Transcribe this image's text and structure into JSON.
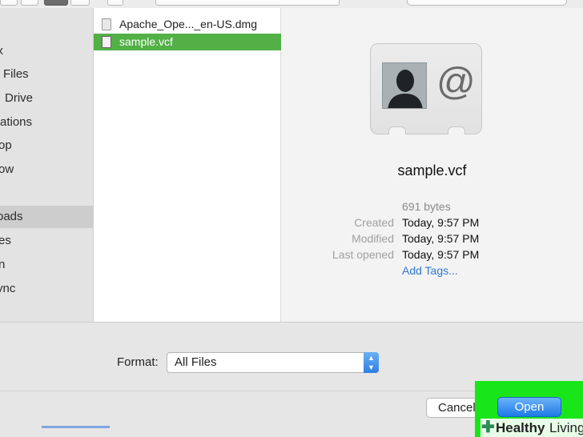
{
  "colors": {
    "selection": "#52b046",
    "accent": "#2e7fe0",
    "link": "#2f78d0",
    "highlight": "#19e619"
  },
  "sidebar": {
    "items": [
      {
        "label": "ox"
      },
      {
        "label": "Files"
      },
      {
        "label": "Drive"
      },
      {
        "label": "ations"
      },
      {
        "label": "op"
      },
      {
        "label": "ow"
      },
      {
        "label": ""
      },
      {
        "label": "oads",
        "selected": true
      },
      {
        "label": "es"
      },
      {
        "label": "n"
      },
      {
        "label": "ync"
      }
    ]
  },
  "files": [
    {
      "name": "Apache_Ope..._en-US.dmg",
      "icon": "disk-image-icon",
      "selected": false
    },
    {
      "name": "sample.vcf",
      "icon": "vcard-file-icon",
      "selected": true
    }
  ],
  "preview": {
    "icon": "contact-card-icon",
    "filename": "sample.vcf",
    "size": "691 bytes",
    "created_label": "Created",
    "created_value": "Today, 9:57 PM",
    "modified_label": "Modified",
    "modified_value": "Today, 9:57 PM",
    "last_opened_label": "Last opened",
    "last_opened_value": "Today, 9:57 PM",
    "add_tags": "Add Tags..."
  },
  "footer": {
    "format_label": "Format:",
    "format_value": "All Files",
    "cancel_label": "Cancel",
    "open_label": "Open"
  },
  "watermark": {
    "part1": "Healthy",
    "part2": "Living"
  }
}
